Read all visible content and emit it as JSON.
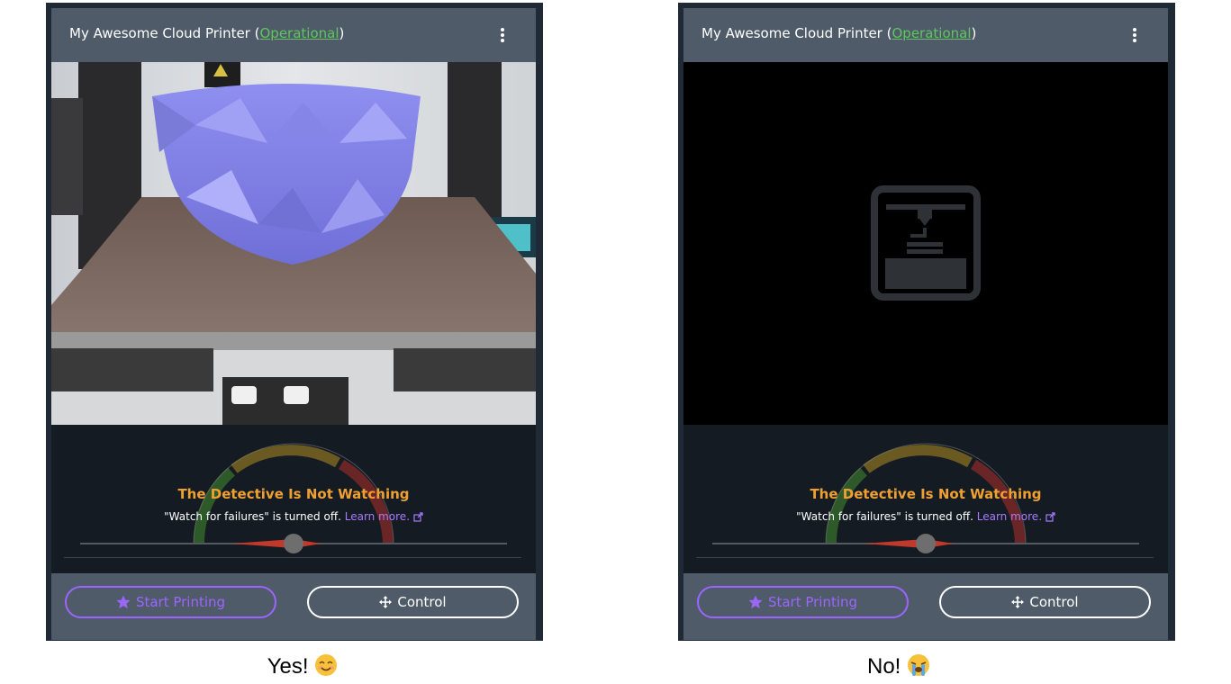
{
  "panels": [
    {
      "header": {
        "printer_name": "My Awesome Cloud Printer (",
        "status": "Operational",
        "close_paren": ")"
      },
      "webcam": {
        "state": "live feed"
      },
      "detective": {
        "title": "The Detective Is Not Watching",
        "subtitle": "\"Watch for failures\" is turned off.",
        "learn_more": "Learn more."
      },
      "buttons": {
        "start": "Start Printing",
        "control": "Control"
      },
      "caption": "Yes!",
      "caption_emoji": "smiling-face-icon"
    },
    {
      "header": {
        "printer_name": "My Awesome Cloud Printer (",
        "status": "Operational",
        "close_paren": ")"
      },
      "webcam": {
        "state": "no feed placeholder"
      },
      "detective": {
        "title": "The Detective Is Not Watching",
        "subtitle": "\"Watch for failures\" is turned off.",
        "learn_more": "Learn more."
      },
      "buttons": {
        "start": "Start Printing",
        "control": "Control"
      },
      "caption": "No!",
      "caption_emoji": "crying-face-icon"
    }
  ],
  "colors": {
    "status_green": "#5fc55f",
    "accent_purple": "#9b66ff",
    "warning_orange": "#f0a030",
    "card_gray": "#4f5b69",
    "dark_bg": "#151b23"
  }
}
